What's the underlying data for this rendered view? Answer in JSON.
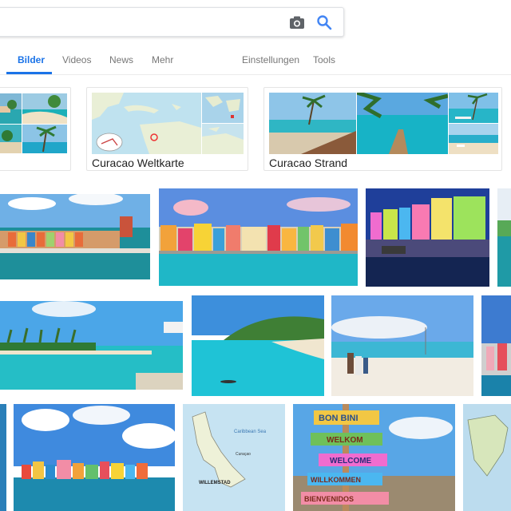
{
  "search": {
    "query": "",
    "camera_icon": "camera-icon",
    "search_icon": "magnifier-icon"
  },
  "tabs": {
    "items": [
      {
        "label": "Bilder",
        "active": true
      },
      {
        "label": "Videos",
        "active": false
      },
      {
        "label": "News",
        "active": false
      },
      {
        "label": "Mehr",
        "active": false
      }
    ],
    "settings": "Einstellungen",
    "tools": "Tools"
  },
  "related": [
    {
      "label": ""
    },
    {
      "label": "Curacao Weltkarte"
    },
    {
      "label": "Curacao Strand"
    }
  ],
  "colors": {
    "accent": "#1a73e8",
    "tab_text": "#777777",
    "border": "#dfe1e5"
  }
}
